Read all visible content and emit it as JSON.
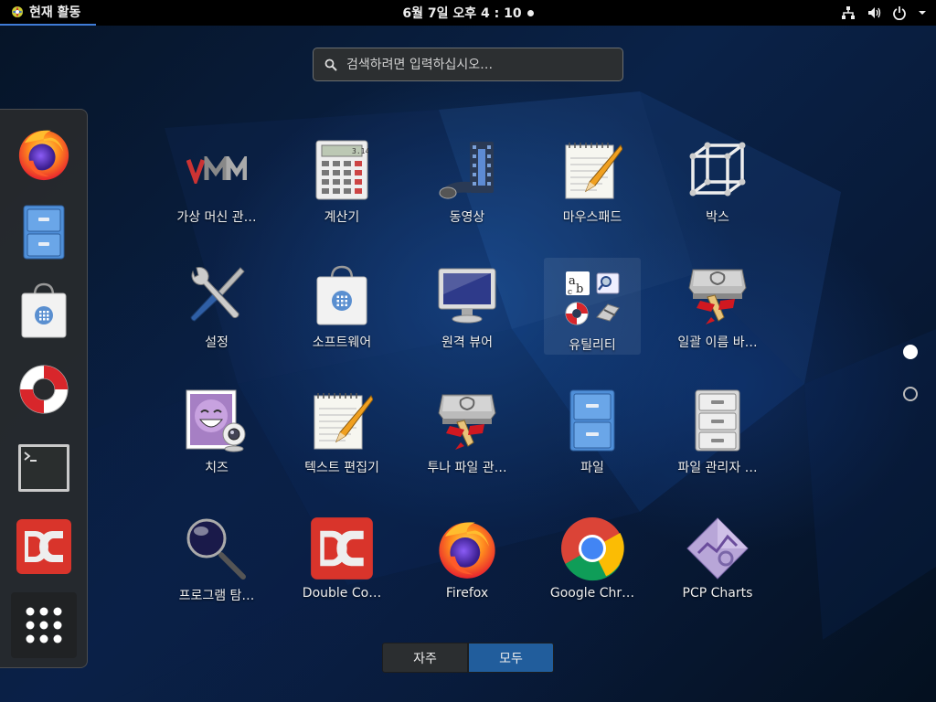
{
  "topbar": {
    "activities_label": "현재 활동",
    "clock": "6월 7일 오후  4 : 10"
  },
  "search": {
    "placeholder": "검색하려면 입력하십시오…"
  },
  "dash": {
    "items": [
      {
        "name": "Firefox",
        "icon": "firefox-icon"
      },
      {
        "name": "파일",
        "icon": "file-cabinet-icon"
      },
      {
        "name": "소프트웨어",
        "icon": "software-bag-icon"
      },
      {
        "name": "도움말",
        "icon": "lifebuoy-icon"
      },
      {
        "name": "터미널",
        "icon": "terminal-icon"
      },
      {
        "name": "Double Commander",
        "icon": "double-commander-icon"
      },
      {
        "name": "프로그램 표시",
        "icon": "app-grid-icon"
      }
    ]
  },
  "apps": [
    {
      "label": "가상 머신 관…",
      "icon": "vmm-icon"
    },
    {
      "label": "계산기",
      "icon": "calculator-icon"
    },
    {
      "label": "동영상",
      "icon": "film-icon"
    },
    {
      "label": "마우스패드",
      "icon": "notepad-icon"
    },
    {
      "label": "박스",
      "icon": "wireframe-box-icon"
    },
    {
      "label": "설정",
      "icon": "tools-icon"
    },
    {
      "label": "소프트웨어",
      "icon": "software-bag-icon"
    },
    {
      "label": "원격 뷰어",
      "icon": "monitor-icon"
    },
    {
      "label": "유틸리티",
      "icon": "utilities-folder-icon"
    },
    {
      "label": "일괄 이름 바…",
      "icon": "bulk-rename-icon"
    },
    {
      "label": "치즈",
      "icon": "cheese-webcam-icon"
    },
    {
      "label": "텍스트 편집기",
      "icon": "text-editor-icon"
    },
    {
      "label": "투나 파일 관…",
      "icon": "thunar-icon"
    },
    {
      "label": "파일",
      "icon": "file-cabinet-icon"
    },
    {
      "label": "파일 관리자 …",
      "icon": "file-manager-icon"
    },
    {
      "label": "프로그램 탐…",
      "icon": "magnifier-icon"
    },
    {
      "label": "Double Co…",
      "icon": "double-commander-icon"
    },
    {
      "label": "Firefox",
      "icon": "firefox-icon"
    },
    {
      "label": "Google Chr…",
      "icon": "chrome-icon"
    },
    {
      "label": "PCP Charts",
      "icon": "pcp-charts-icon"
    }
  ],
  "tabs": {
    "frequent": "자주",
    "all": "모두"
  },
  "colors": {
    "accent": "#215d9c",
    "topbar": "#000000"
  }
}
